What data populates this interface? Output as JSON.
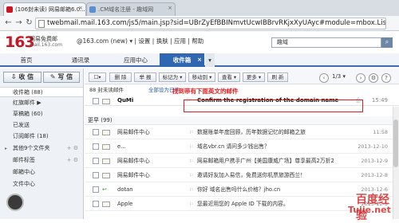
{
  "browser": {
    "tabs": [
      {
        "label": "(106封未读) 网易邮箱6.0...",
        "active": true
      },
      {
        "label": ".CM域名注册 - 趣域网",
        "active": false
      }
    ],
    "url": "twebmail.mail.163.com/js5/main.jsp?sid=UBrZyEfBBINmvtUcwIBBrvRKjxXyUAyc#module=mbox.ListModule"
  },
  "header": {
    "logo": "163",
    "logo_sub1": "网易免费邮",
    "logo_sub2": "mail.163.com",
    "account": "@163.com (new) ▾ | 设置 | 换肤 | 应用 | 帮助",
    "search_value": "趣域"
  },
  "nav": {
    "tabs": [
      {
        "label": "首页"
      },
      {
        "label": "通讯录"
      },
      {
        "label": "应用中心"
      },
      {
        "label": "收件箱",
        "active": true
      }
    ]
  },
  "sidebar": {
    "receive_label": "收 信",
    "write_label": "写 信",
    "folders": [
      {
        "label": "收件箱 (88)",
        "active": true
      },
      {
        "label": "红旗邮件 ▶"
      },
      {
        "label": "草稿箱 (60)"
      },
      {
        "label": "已发送"
      },
      {
        "label": "订阅邮件 (18)"
      },
      {
        "label": "其他9个文件夹"
      },
      {
        "label": "邮件标签"
      },
      {
        "label": "邮箱中心"
      },
      {
        "label": "文件中心"
      }
    ]
  },
  "toolbar": {
    "buttons": [
      "删 除",
      "举 报",
      "标记为 ▾",
      "移动到 ▾",
      "查看 ▾",
      "更多 ▾",
      "刷 新"
    ],
    "pager": "1/3 ▾"
  },
  "viewline": {
    "text": "88 封未读邮件",
    "links": "全部设为已读"
  },
  "annotation": "找到带有下面英文的邮件",
  "top_mail": {
    "sender": "QuMi",
    "subject": "Confirm the registration of the domain name",
    "date": "15:49"
  },
  "group_today": "更早 (99)",
  "rows": [
    {
      "sender": "网易邮件中心",
      "subject": "数据账单年度回顾，历年数据记忆的邮箱之旅",
      "date": "11:58"
    },
    {
      "sender": "e...",
      "subject": "域名vbr.cn 请问多少钱出售？",
      "date": "2013-12-10"
    },
    {
      "sender": "网易邮件中心",
      "subject": "网易邮箱用户携手广州【美国康威广场】尊享最高2万折2",
      "date": "2013-12-9"
    },
    {
      "sender": "网易邮件中心",
      "subject": "邀请好友加入易信，免费送你机票旅游西兰！",
      "date": "2013-12-8"
    },
    {
      "sender": "dotan",
      "subject": "你好 域名出售吗什么价格？jho.cn",
      "date": "2013-12-6"
    },
    {
      "sender": "Apple",
      "subject": "您最近用您的 Apple ID 下载的内容。",
      "date": "2013-12-5"
    }
  ],
  "watermark": {
    "line1": "百度经验",
    "line2": "Tujie.net"
  }
}
